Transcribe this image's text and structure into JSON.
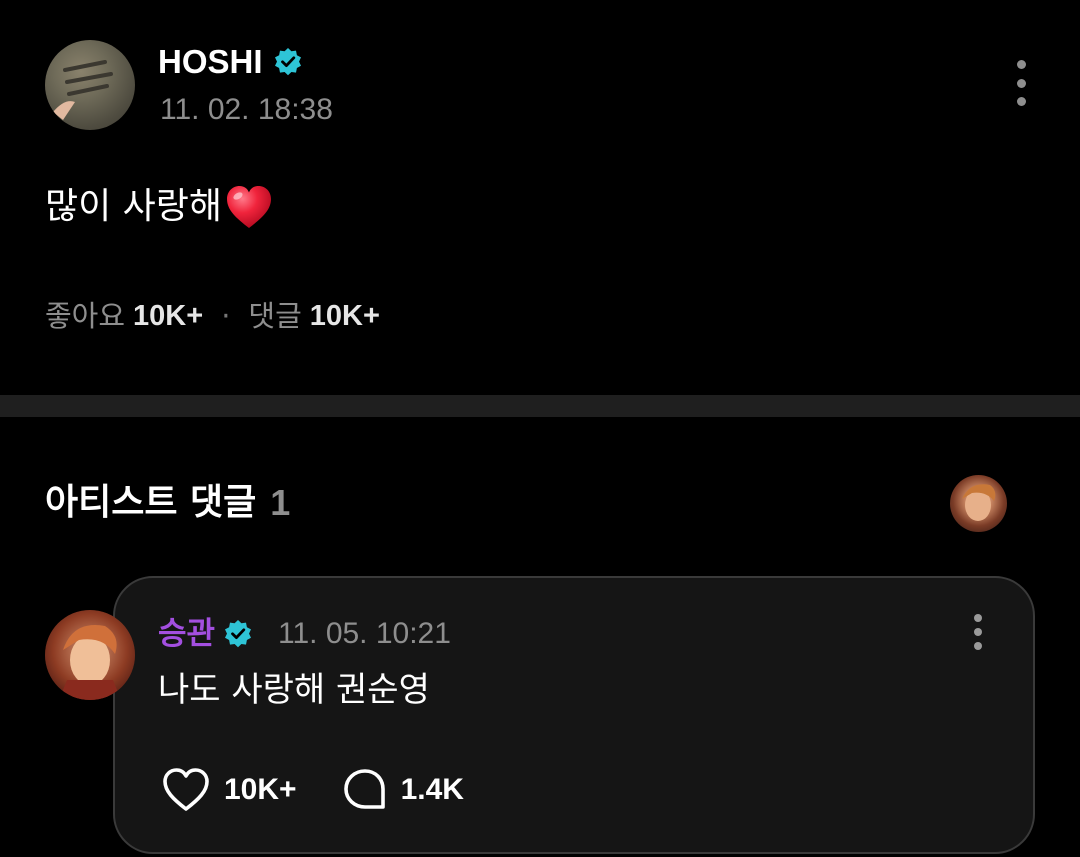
{
  "post": {
    "author": "HOSHI",
    "timestamp": "11. 02. 18:38",
    "text": "많이 사랑해",
    "stats": {
      "likes_label": "좋아요",
      "likes_count": "10K+",
      "separator": "·",
      "comments_label": "댓글",
      "comments_count": "10K+"
    }
  },
  "section": {
    "title": "아티스트 댓글",
    "count": "1"
  },
  "comment": {
    "author": "승관",
    "timestamp": "11. 05. 10:21",
    "text": "나도 사랑해 권순영",
    "like_count": "10K+",
    "reply_count": "1.4K"
  },
  "colors": {
    "background": "#000000",
    "verified_badge": "#2ec4d6",
    "comment_author": "#a34fe0",
    "muted_text": "#8e8e8e",
    "divider": "#1f1f1f",
    "heart_emoji": "#f0243c"
  },
  "icons": {
    "verified": "verified-badge-icon",
    "more": "more-vertical-icon",
    "heart_emoji": "red-heart-emoji",
    "like": "heart-outline-icon",
    "reply": "speech-bubble-icon"
  }
}
